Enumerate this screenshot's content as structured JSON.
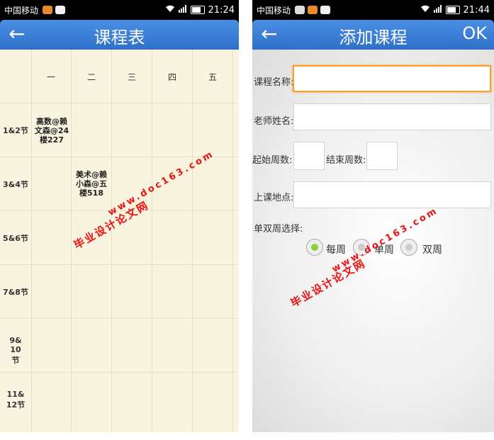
{
  "left": {
    "status": {
      "carrier": "中国移动",
      "time": "21:24"
    },
    "header": {
      "back_icon": "←",
      "title": "课程表"
    },
    "days": [
      "一",
      "二",
      "三",
      "四",
      "五"
    ],
    "periods": [
      "1&2节",
      "3&4节",
      "5&6节",
      "7&8节",
      "9&10节",
      "11&12节"
    ],
    "courses": [
      {
        "text": "高数@赖文森@24楼227",
        "day_index": 0,
        "period_index": 0
      },
      {
        "text": "美术@赖小森@五楼518",
        "day_index": 1,
        "period_index": 1
      }
    ]
  },
  "right": {
    "status": {
      "carrier": "中国移动",
      "time": "21:44"
    },
    "header": {
      "back_icon": "←",
      "title": "添加课程",
      "ok_label": "OK"
    },
    "form": {
      "course_name_label": "课程名称:",
      "teacher_label": "老师姓名:",
      "start_week_label": "起始周数:",
      "end_week_label": "结束周数:",
      "location_label": "上课地点:",
      "week_type_label": "单双周选择:",
      "options": [
        "每周",
        "单周",
        "双周"
      ],
      "selected_option": "每周"
    }
  },
  "watermark": {
    "line1": "毕业设计论文网",
    "line2": "www.doc163.com"
  }
}
